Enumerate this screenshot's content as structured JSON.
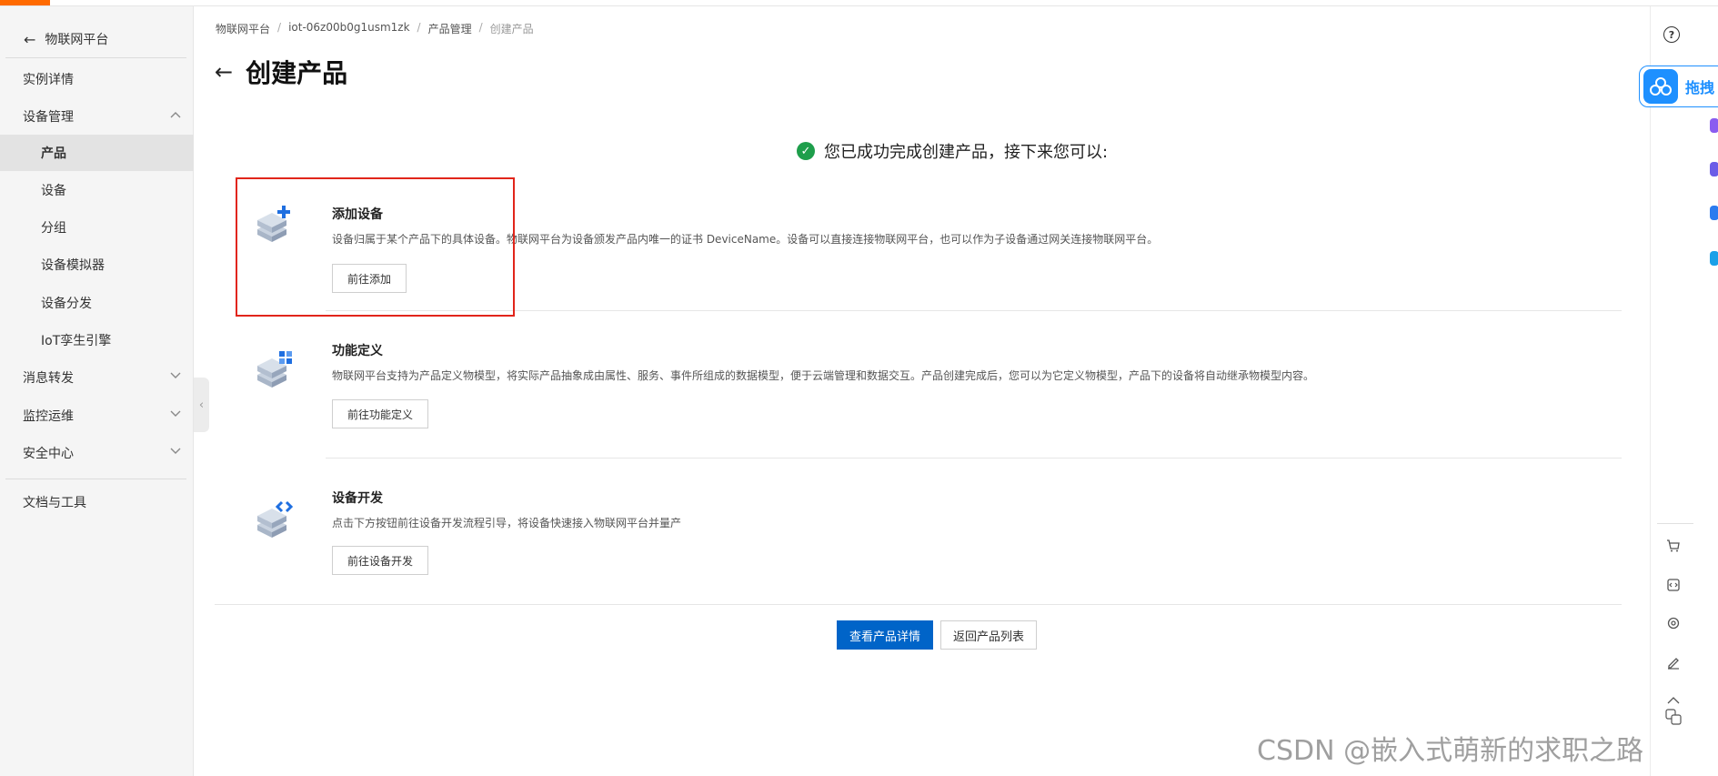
{
  "sidebar": {
    "back_label": "物联网平台",
    "items": [
      {
        "label": "实例详情"
      },
      {
        "label": "设备管理"
      },
      {
        "label": "产品"
      },
      {
        "label": "设备"
      },
      {
        "label": "分组"
      },
      {
        "label": "设备模拟器"
      },
      {
        "label": "设备分发"
      },
      {
        "label": "IoT孪生引擎"
      },
      {
        "label": "消息转发"
      },
      {
        "label": "监控运维"
      },
      {
        "label": "安全中心"
      },
      {
        "label": "文档与工具"
      }
    ]
  },
  "breadcrumb": [
    "物联网平台",
    "iot-06z00b0g1usm1zk",
    "产品管理",
    "创建产品"
  ],
  "breadcrumb_sep": "/",
  "page_title": "创建产品",
  "success_message": "您已成功完成创建产品，接下来您可以:",
  "cards": [
    {
      "title": "添加设备",
      "desc": "设备归属于某个产品下的具体设备。物联网平台为设备颁发产品内唯一的证书 DeviceName。设备可以直接连接物联网平台，也可以作为子设备通过网关连接物联网平台。",
      "button": "前往添加"
    },
    {
      "title": "功能定义",
      "desc": "物联网平台支持为产品定义物模型，将实际产品抽象成由属性、服务、事件所组成的数据模型，便于云端管理和数据交互。产品创建完成后，您可以为它定义物模型，产品下的设备将自动继承物模型内容。",
      "button": "前往功能定义"
    },
    {
      "title": "设备开发",
      "desc": "点击下方按钮前往设备开发流程引导，将设备快速接入物联网平台并量产",
      "button": "前往设备开发"
    }
  ],
  "footer_buttons": {
    "primary": "查看产品详情",
    "secondary": "返回产品列表"
  },
  "floating_widget": {
    "label": "拖拽"
  },
  "watermark": "CSDN @嵌入式萌新的求职之路",
  "colors": {
    "primary": "#0064c8",
    "brand": "#ff6a00",
    "success": "#1e9e4b",
    "highlight_box": "#e1251b"
  }
}
